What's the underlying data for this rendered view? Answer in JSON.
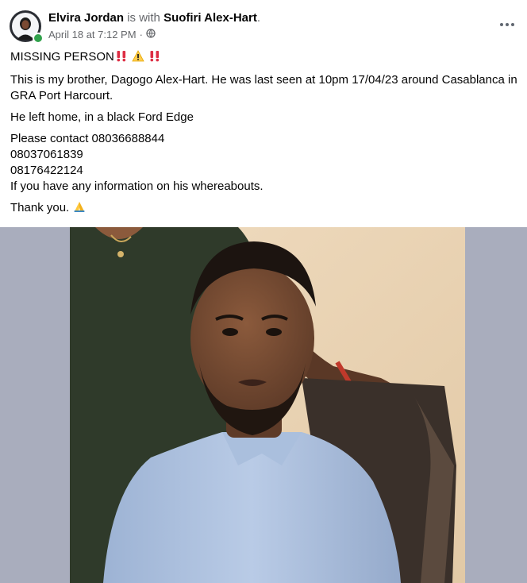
{
  "post": {
    "author": "Elvira Jordan",
    "with_text": " is with ",
    "tagged": "Suofiri Alex-Hart",
    "period": ".",
    "timestamp": "April 18 at 7:12 PM",
    "separator": "·",
    "audience_icon": "globe-icon",
    "more_icon": "more-dots-icon",
    "lines": {
      "l1": "MISSING PERSON",
      "l2": "This is my brother, Dagogo Alex-Hart. He was last seen at 10pm 17/04/23 around Casablanca in GRA Port Harcourt.",
      "l3": "He left home, in a black Ford Edge",
      "l4": "Please contact 08036688844",
      "l5": "08037061839",
      "l6": "08176422124",
      "l7": "If you have any information on his whereabouts.",
      "l8": "Thank you."
    },
    "emoji_icons": [
      "double-exclamation-icon",
      "warning-icon",
      "double-exclamation-icon",
      "folded-hands-icon"
    ]
  },
  "colors": {
    "name": "#050505",
    "meta": "#65676b",
    "online": "#31a24c",
    "exclaim": "#dd2e44",
    "warning": "#ffcc4d",
    "photo_side": "#a9adbd"
  }
}
